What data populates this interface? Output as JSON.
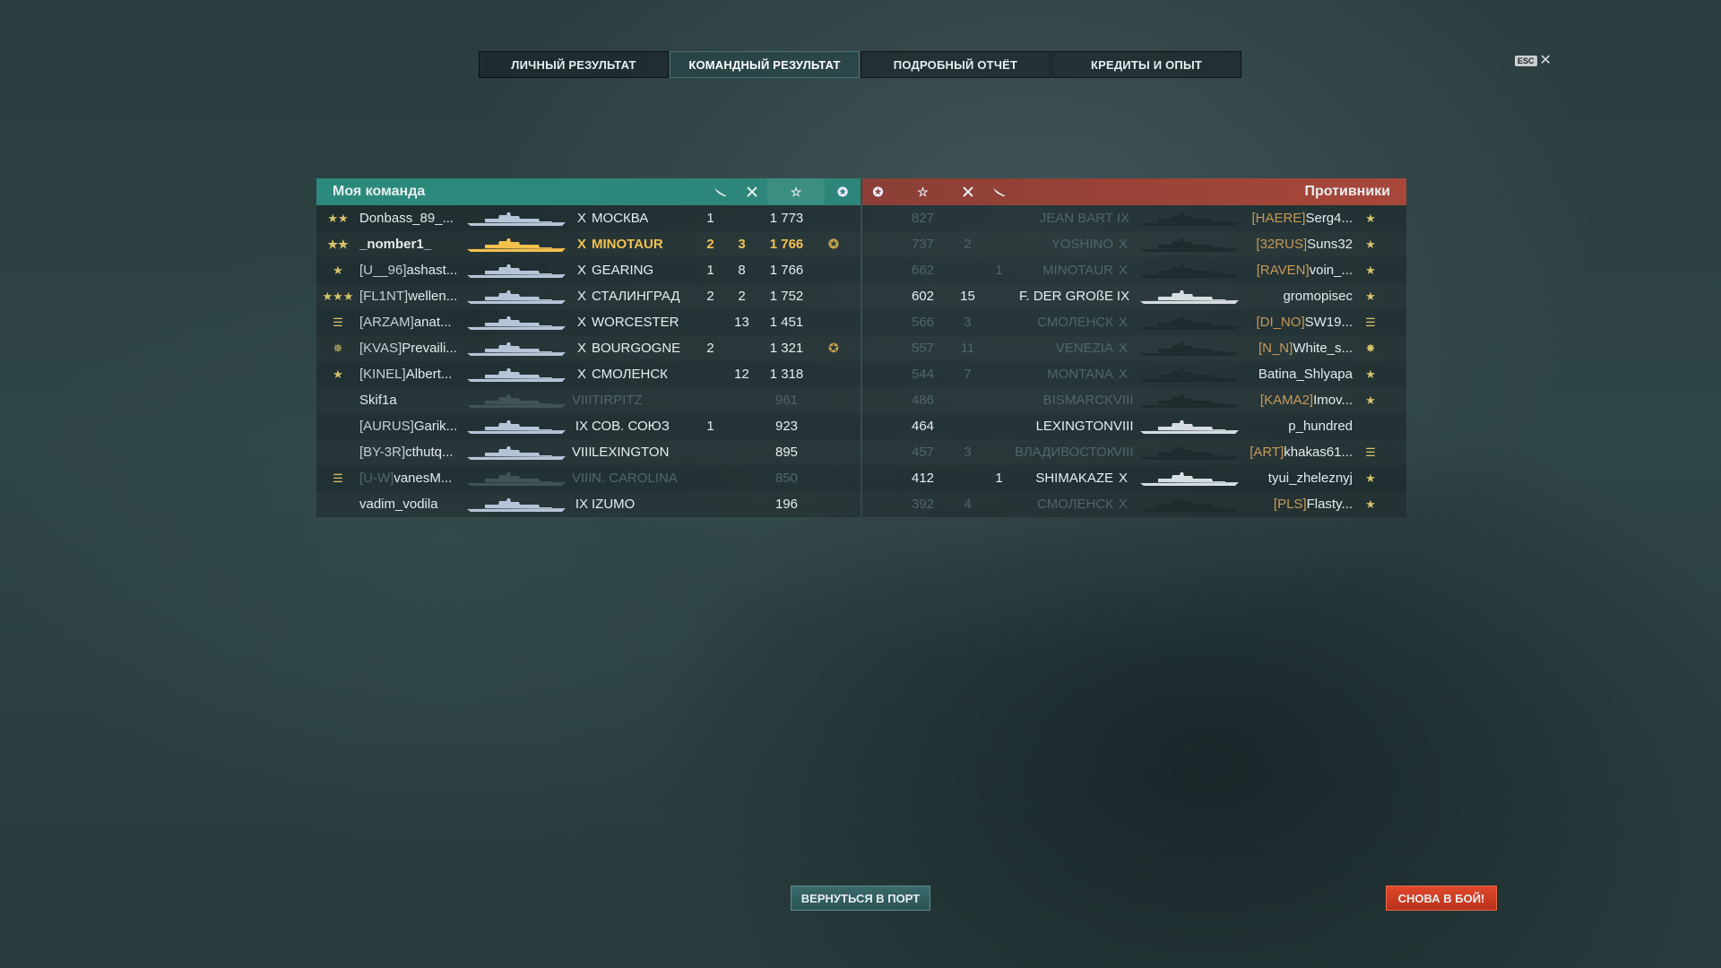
{
  "tabs": [
    {
      "label": "ЛИЧНЫЙ РЕЗУЛЬТАТ",
      "active": false
    },
    {
      "label": "КОМАНДНЫЙ РЕЗУЛЬТАТ",
      "active": true
    },
    {
      "label": "ПОДРОБНЫЙ ОТЧЁТ",
      "active": false
    },
    {
      "label": "КРЕДИТЫ И ОПЫТ",
      "active": false
    }
  ],
  "esc": {
    "key": "ESC",
    "close": "✕"
  },
  "my_team": {
    "title": "Моя команда",
    "header_icons": [
      "plane-icon",
      "crossed-swords-icon",
      "star-icon",
      "laurel-icon"
    ],
    "rows": [
      {
        "rank": "★★",
        "clan": "",
        "name": "Donbass_89_...",
        "tier": "X",
        "ship": "МОСКВА",
        "a": "1",
        "b": "",
        "xp": "1 773",
        "medal": "",
        "style": "normal"
      },
      {
        "rank": "★★",
        "clan": "",
        "name": "_nomber1_",
        "tier": "X",
        "ship": "MINOTAUR",
        "a": "2",
        "b": "3",
        "xp": "1 766",
        "medal": "✪",
        "style": "self"
      },
      {
        "rank": "★",
        "clan": "[U__96]",
        "name": "ashast...",
        "tier": "X",
        "ship": "GEARING",
        "a": "1",
        "b": "8",
        "xp": "1 766",
        "medal": "",
        "style": "normal"
      },
      {
        "rank": "★★★",
        "clan": "[FL1NT]",
        "name": "wellen...",
        "tier": "X",
        "ship": "СТАЛИНГРАД",
        "a": "2",
        "b": "2",
        "xp": "1 752",
        "medal": "",
        "style": "normal"
      },
      {
        "rank": "☰",
        "clan": "[ARZAM]",
        "name": "anat...",
        "tier": "X",
        "ship": "WORCESTER",
        "a": "",
        "b": "13",
        "xp": "1 451",
        "medal": "",
        "style": "normal"
      },
      {
        "rank": "✵",
        "clan": "[KVAS]",
        "name": "Prevaili...",
        "tier": "X",
        "ship": "BOURGOGNE",
        "a": "2",
        "b": "",
        "xp": "1 321",
        "medal": "✪",
        "style": "normal"
      },
      {
        "rank": "★",
        "clan": "[KINEL]",
        "name": "Albert...",
        "tier": "X",
        "ship": "СМОЛЕНСК",
        "a": "",
        "b": "12",
        "xp": "1 318",
        "medal": "",
        "style": "normal"
      },
      {
        "rank": "",
        "clan": "",
        "name": "Skif1a",
        "tier": "VIII",
        "ship": "TIRPITZ",
        "a": "",
        "b": "",
        "xp": "961",
        "medal": "",
        "style": "dead"
      },
      {
        "rank": "",
        "clan": "[AURUS]",
        "name": "Garik...",
        "tier": "IX",
        "ship": "СОВ. СОЮЗ",
        "a": "1",
        "b": "",
        "xp": "923",
        "medal": "",
        "style": "normal"
      },
      {
        "rank": "",
        "clan": "[BY-3R]",
        "name": "cthutq...",
        "tier": "VIII",
        "ship": "LEXINGTON",
        "a": "",
        "b": "",
        "xp": "895",
        "medal": "",
        "style": "normal"
      },
      {
        "rank": "☰",
        "clan": "[U-W]",
        "name": "vanesM...",
        "tier": "VIII",
        "ship": "N. CAROLINA",
        "a": "",
        "b": "",
        "xp": "850",
        "medal": "",
        "style": "dead"
      },
      {
        "rank": "",
        "clan": "",
        "name": "vadim_vodila",
        "tier": "IX",
        "ship": "IZUMO",
        "a": "",
        "b": "",
        "xp": "196",
        "medal": "",
        "style": "normal"
      }
    ]
  },
  "enemy_team": {
    "title": "Противники",
    "header_icons": [
      "laurel-icon",
      "star-icon",
      "crossed-swords-icon",
      "plane-icon"
    ],
    "rows": [
      {
        "xp": "827",
        "b": "",
        "a": "",
        "ship": "JEAN BART",
        "tier": "IX",
        "clan": "[HAERE]",
        "name": "Serg4...",
        "rank": "★",
        "style": "dead"
      },
      {
        "xp": "737",
        "b": "2",
        "a": "",
        "ship": "YOSHINO",
        "tier": "X",
        "clan": "[32RUS]",
        "name": "Suns32",
        "rank": "★",
        "style": "dead"
      },
      {
        "xp": "662",
        "b": "",
        "a": "1",
        "ship": "MINOTAUR",
        "tier": "X",
        "clan": "[RAVEN]",
        "name": "voin_...",
        "rank": "★",
        "style": "dead"
      },
      {
        "xp": "602",
        "b": "15",
        "a": "",
        "ship": "F. DER GROßE",
        "tier": "IX",
        "clan": "",
        "name": "gromopisec",
        "rank": "★",
        "style": "normal"
      },
      {
        "xp": "566",
        "b": "3",
        "a": "",
        "ship": "СМОЛЕНСК",
        "tier": "X",
        "clan": "[DI_NO]",
        "name": "SW19...",
        "rank": "☰",
        "style": "dead"
      },
      {
        "xp": "557",
        "b": "11",
        "a": "",
        "ship": "VENEZIA",
        "tier": "X",
        "clan": "[N_N]",
        "name": "White_s...",
        "rank": "✸",
        "style": "dead"
      },
      {
        "xp": "544",
        "b": "7",
        "a": "",
        "ship": "MONTANA",
        "tier": "X",
        "clan": "",
        "name": "Batina_Shlyapa",
        "rank": "★",
        "style": "dead"
      },
      {
        "xp": "486",
        "b": "",
        "a": "",
        "ship": "BISMARCK",
        "tier": "VIII",
        "clan": "[KAMA2]",
        "name": "Imov...",
        "rank": "★",
        "style": "dead"
      },
      {
        "xp": "464",
        "b": "",
        "a": "",
        "ship": "LEXINGTON",
        "tier": "VIII",
        "clan": "",
        "name": "p_hundred",
        "rank": "",
        "style": "normal"
      },
      {
        "xp": "457",
        "b": "3",
        "a": "",
        "ship": "ВЛАДИВОСТОК",
        "tier": "VIII",
        "clan": "[ART]",
        "name": "khakas61...",
        "rank": "☰",
        "style": "dead"
      },
      {
        "xp": "412",
        "b": "",
        "a": "1",
        "ship": "SHIMAKAZE",
        "tier": "X",
        "clan": "",
        "name": "tyui_zheleznyj",
        "rank": "★",
        "style": "normal"
      },
      {
        "xp": "392",
        "b": "4",
        "a": "",
        "ship": "СМОЛЕНСК",
        "tier": "X",
        "clan": "[PLS]",
        "name": "Flasty...",
        "rank": "★",
        "style": "dead"
      }
    ]
  },
  "buttons": {
    "port": "ВЕРНУТЬСЯ В ПОРТ",
    "battle": "СНОВА В БОЙ!"
  },
  "colors": {
    "my_team": "#2b8a7d",
    "enemy_team": "#a8473a",
    "self_highlight": "#f2c14e",
    "battle_button": "#d23d22"
  }
}
